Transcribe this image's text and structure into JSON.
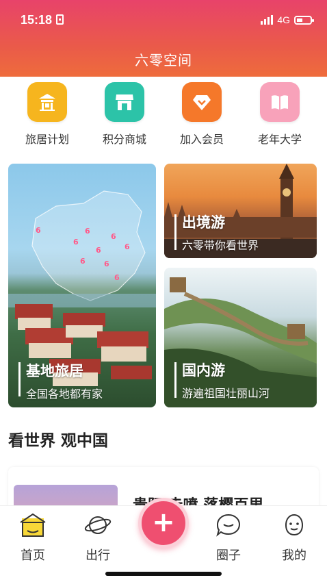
{
  "status": {
    "time": "15:18",
    "network": "4G"
  },
  "app": {
    "title": "六零空间"
  },
  "quick_menu": [
    {
      "label": "旅居计划",
      "icon": "pavilion-icon",
      "color": "#f6b51e"
    },
    {
      "label": "积分商城",
      "icon": "shop-icon",
      "color": "#2cc3a8"
    },
    {
      "label": "加入会员",
      "icon": "diamond-icon",
      "color": "#f5782a"
    },
    {
      "label": "老年大学",
      "icon": "book-icon",
      "color": "#f8a2ba"
    }
  ],
  "cards": {
    "base": {
      "title": "基地旅居",
      "subtitle": "全国各地都有家"
    },
    "outbound": {
      "title": "出境游",
      "subtitle": "六零带你看世界"
    },
    "domestic": {
      "title": "国内游",
      "subtitle": "游遍祖国壮丽山河"
    }
  },
  "section": {
    "title": "看世界 观中国"
  },
  "article": {
    "title": "贵阳 赤喷 落樱百里"
  },
  "tabbar": {
    "home": "首页",
    "travel": "出行",
    "add": "+",
    "circle": "圈子",
    "mine": "我的"
  },
  "colors": {
    "brand": "#e8436a",
    "accent_fab": "#ef4f70"
  }
}
